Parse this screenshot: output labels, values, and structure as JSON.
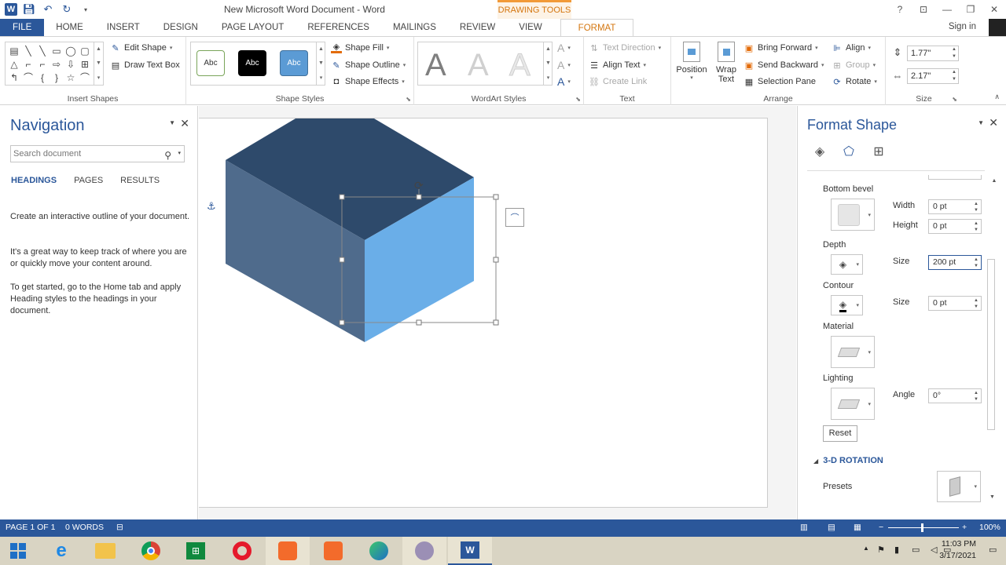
{
  "app": {
    "title": "New Microsoft Word Document - Word",
    "context_tab": "DRAWING TOOLS",
    "signin": "Sign in"
  },
  "tabs": [
    "FILE",
    "HOME",
    "INSERT",
    "DESIGN",
    "PAGE LAYOUT",
    "REFERENCES",
    "MAILINGS",
    "REVIEW",
    "VIEW",
    "FORMAT"
  ],
  "ribbon": {
    "insert_shapes": {
      "label": "Insert Shapes",
      "edit_shape": "Edit Shape",
      "draw_text_box": "Draw Text Box"
    },
    "shape_styles": {
      "label": "Shape Styles",
      "style1": "Abc",
      "style2": "Abc",
      "style3": "Abc",
      "shape_fill": "Shape Fill",
      "shape_outline": "Shape Outline",
      "shape_effects": "Shape Effects"
    },
    "wordart": {
      "label": "WordArt Styles",
      "letter": "A"
    },
    "text": {
      "label": "Text",
      "text_direction": "Text Direction",
      "align_text": "Align Text",
      "create_link": "Create Link"
    },
    "arrange": {
      "label": "Arrange",
      "position": "Position",
      "wrap_text": "Wrap Text",
      "bring_forward": "Bring Forward",
      "send_backward": "Send Backward",
      "selection_pane": "Selection Pane",
      "align": "Align",
      "group": "Group",
      "rotate": "Rotate"
    },
    "size": {
      "label": "Size",
      "height": "1.77\"",
      "width": "2.17\""
    }
  },
  "nav": {
    "title": "Navigation",
    "search_placeholder": "Search document",
    "tabs": [
      "HEADINGS",
      "PAGES",
      "RESULTS"
    ],
    "p1": "Create an interactive outline of your document.",
    "p2": "It's a great way to keep track of where you are or quickly move your content around.",
    "p3": "To get started, go to the Home tab and apply Heading styles to the headings in your document."
  },
  "format_shape": {
    "title": "Format Shape",
    "bottom_bevel": "Bottom bevel",
    "width_label": "Width",
    "width_value": "0 pt",
    "height_label": "Height",
    "height_value": "0 pt",
    "depth": "Depth",
    "depth_size_label": "Size",
    "depth_size_value": "200 pt",
    "contour": "Contour",
    "contour_size_label": "Size",
    "contour_size_value": "0 pt",
    "material": "Material",
    "lighting": "Lighting",
    "angle_label": "Angle",
    "angle_value": "0°",
    "reset": "Reset",
    "rotation_header": "3-D ROTATION",
    "presets": "Presets"
  },
  "status": {
    "page": "PAGE 1 OF 1",
    "words": "0 WORDS",
    "zoom": "100%"
  },
  "taskbar": {
    "time": "11:03 PM",
    "date": "3/17/2021"
  },
  "colors": {
    "word_blue": "#2b579a",
    "cube_top": "#2e4a6b",
    "cube_left": "#4f6b8c",
    "cube_right": "#6aaee8",
    "format_orange": "#d4760f"
  }
}
